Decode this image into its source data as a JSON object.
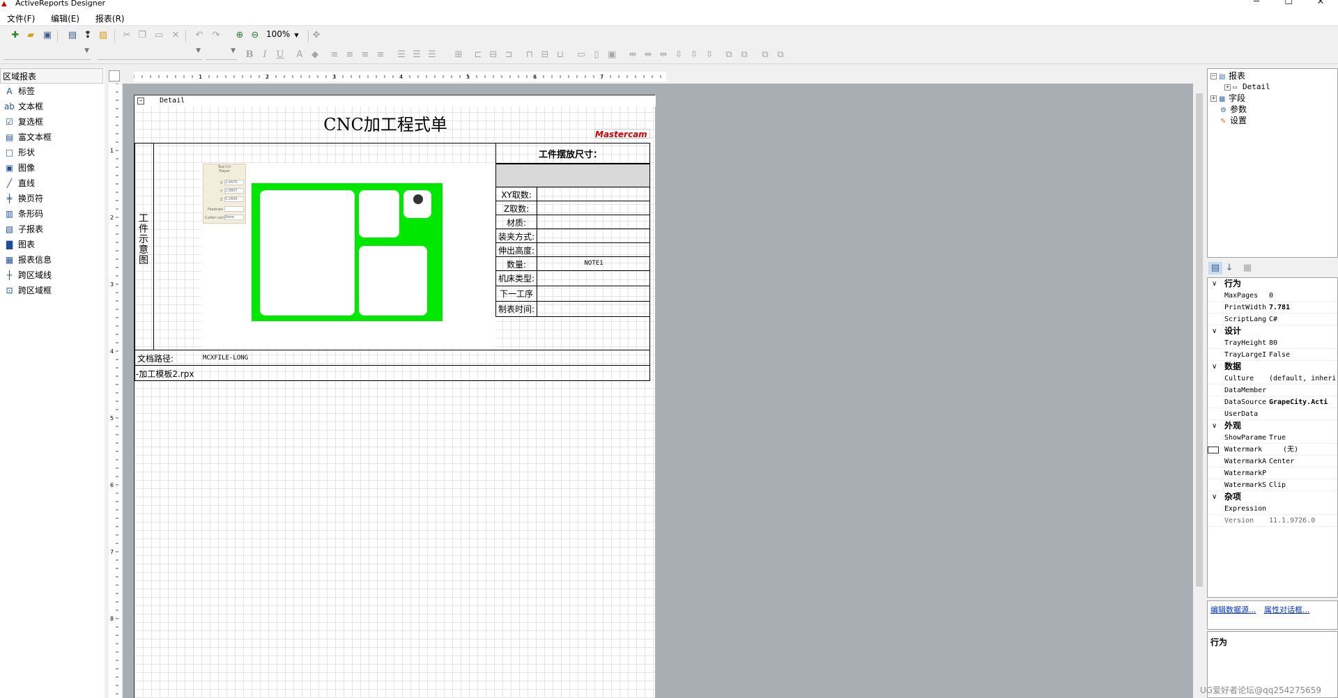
{
  "window": {
    "title": "ActiveReports Designer",
    "min": "─",
    "max": "☐",
    "close": "✕"
  },
  "menu": [
    "文件(F)",
    "编辑(E)",
    "报表(R)"
  ],
  "toolbar": {
    "zoom": "100%"
  },
  "toolbox": {
    "header": "区域报表",
    "items": [
      {
        "icon": "label-icon",
        "glyph": "A",
        "label": "标签"
      },
      {
        "icon": "textbox-icon",
        "glyph": "ab",
        "label": "文本框"
      },
      {
        "icon": "checkbox-icon",
        "glyph": "☑",
        "label": "复选框"
      },
      {
        "icon": "richtext-icon",
        "glyph": "▤",
        "label": "富文本框"
      },
      {
        "icon": "shape-icon",
        "glyph": "□",
        "label": "形状"
      },
      {
        "icon": "picture-icon",
        "glyph": "▣",
        "label": "图像"
      },
      {
        "icon": "line-icon",
        "glyph": "╱",
        "label": "直线"
      },
      {
        "icon": "pagebreak-icon",
        "glyph": "╪",
        "label": "换页符"
      },
      {
        "icon": "barcode-icon",
        "glyph": "▥",
        "label": "条形码"
      },
      {
        "icon": "subreport-icon",
        "glyph": "▧",
        "label": "子报表"
      },
      {
        "icon": "chart-icon",
        "glyph": "▇",
        "label": "图表"
      },
      {
        "icon": "reportinfo-icon",
        "glyph": "▦",
        "label": "报表信息"
      },
      {
        "icon": "crossline-icon",
        "glyph": "┼",
        "label": "跨区域线"
      },
      {
        "icon": "crossbox-icon",
        "glyph": "⊡",
        "label": "跨区域框"
      }
    ]
  },
  "ruler": {
    "h": [
      "1",
      "2",
      "3",
      "4",
      "5",
      "6",
      "7"
    ],
    "v": [
      "1",
      "2",
      "3",
      "4",
      "5",
      "6",
      "7",
      "8"
    ]
  },
  "report": {
    "section": "Detail",
    "title": "CNC加工程式单",
    "logo": "Mastercam",
    "vertical_label": "工\n件\n示\n意\n图",
    "size_label": "工件摆放尺寸：",
    "rows": [
      "XY取数:",
      "Z取数:",
      "材质:",
      "装夹方式:",
      "伸出高度:",
      "数量:",
      "机床类型:",
      "下一工序",
      "制表时间:"
    ],
    "qty_value": "NOTE1",
    "path_label": "文档路径:",
    "path_value": "MCXFILE-LONG",
    "template_name": "-加工模板2.rpx",
    "panel": {
      "title": "Tool Ctr\nPlayer",
      "x": "X",
      "y": "Y",
      "z": "Z",
      "xv": "2.9476",
      "yv": "2.0807",
      "zv": "0.2606",
      "f": "Feedrate",
      "c": "Cutter comp",
      "cv": "None"
    }
  },
  "tree": {
    "root": "报表",
    "detail": "Detail",
    "fields": "字段",
    "params": "参数",
    "settings": "设置"
  },
  "properties": {
    "categories": [
      {
        "name": "行为",
        "rows": [
          [
            "MaxPages",
            "0"
          ],
          [
            "PrintWidth",
            "7.781"
          ],
          [
            "ScriptLang",
            "C#"
          ]
        ]
      },
      {
        "name": "设计",
        "rows": [
          [
            "TrayHeight",
            "80"
          ],
          [
            "TrayLargeI",
            "False"
          ]
        ]
      },
      {
        "name": "数据",
        "rows": [
          [
            "Culture",
            "(default, inheri"
          ],
          [
            "DataMember",
            ""
          ],
          [
            "DataSource",
            "GrapeCity.Acti"
          ],
          [
            "UserData",
            ""
          ]
        ]
      },
      {
        "name": "外观",
        "rows": [
          [
            "ShowParame",
            "True"
          ],
          [
            "Watermark",
            "(无)"
          ],
          [
            "WatermarkA",
            "Center"
          ],
          [
            "WatermarkP",
            ""
          ],
          [
            "WatermarkS",
            "Clip"
          ]
        ]
      },
      {
        "name": "杂项",
        "rows": [
          [
            "Expression",
            ""
          ],
          [
            "Version",
            "11.1.9726.0"
          ]
        ]
      }
    ],
    "links": [
      "编辑数据源...",
      "属性对话框..."
    ],
    "desc": "行为"
  },
  "watermark": "UG爱好者论坛@qq254275659"
}
